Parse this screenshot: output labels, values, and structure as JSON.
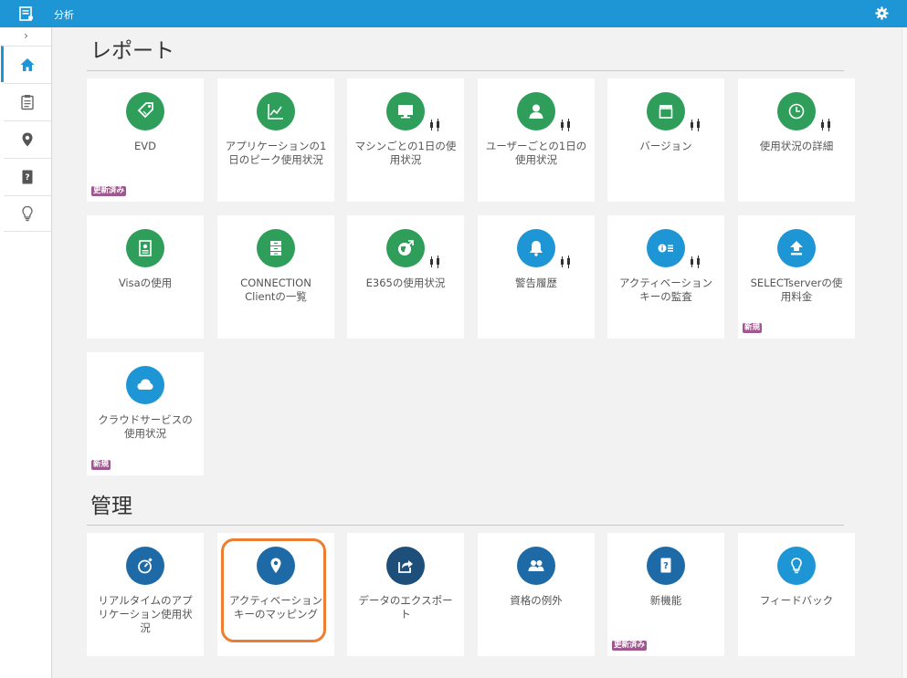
{
  "header": {
    "title": "分析",
    "app_icon": "report-app-icon",
    "settings_icon": "gear-icon",
    "accent": "#1e96d6"
  },
  "sidebar": {
    "expand_glyph": "›",
    "items": [
      {
        "name": "home",
        "icon": "home-icon",
        "active": true
      },
      {
        "name": "reports",
        "icon": "clipboard-icon"
      },
      {
        "name": "location",
        "icon": "map-pin-icon"
      },
      {
        "name": "help",
        "icon": "question-book-icon"
      },
      {
        "name": "ideas",
        "icon": "lightbulb-icon"
      }
    ]
  },
  "sections": {
    "reports": {
      "title": "レポート",
      "tiles": [
        {
          "label": "EVD",
          "icon": "tag-icon",
          "color": "#2f9e5a",
          "bars": false,
          "badge": "更新済み"
        },
        {
          "label": "アプリケーションの1日のピーク使用状況",
          "icon": "chart-line-icon",
          "color": "#2f9e5a",
          "bars": false,
          "badge": ""
        },
        {
          "label": "マシンごとの1日の使用状況",
          "icon": "monitor-icon",
          "color": "#2f9e5a",
          "bars": true,
          "badge": ""
        },
        {
          "label": "ユーザーごとの1日の使用状況",
          "icon": "user-icon",
          "color": "#2f9e5a",
          "bars": true,
          "badge": ""
        },
        {
          "label": "バージョン",
          "icon": "archive-icon",
          "color": "#2f9e5a",
          "bars": true,
          "badge": ""
        },
        {
          "label": "使用状況の詳細",
          "icon": "clock-icon",
          "color": "#2f9e5a",
          "bars": true,
          "badge": ""
        },
        {
          "label": "Visaの使用",
          "icon": "id-card-icon",
          "color": "#2f9e5a",
          "bars": false,
          "badge": ""
        },
        {
          "label": "CONNECTION Clientの一覧",
          "icon": "drawers-icon",
          "color": "#2f9e5a",
          "bars": false,
          "badge": ""
        },
        {
          "label": "E365の使用状況",
          "icon": "globe-icon",
          "color": "#2f9e5a",
          "bars": true,
          "badge": ""
        },
        {
          "label": "警告履歴",
          "icon": "bell-icon",
          "color": "#1e96d6",
          "bars": true,
          "badge": ""
        },
        {
          "label": "アクティベーションキーの監査",
          "icon": "info-list-icon",
          "color": "#1e96d6",
          "bars": true,
          "badge": ""
        },
        {
          "label": "SELECTserverの使用料金",
          "icon": "upload-icon",
          "color": "#1e96d6",
          "bars": false,
          "badge": "新規"
        },
        {
          "label": "クラウドサービスの使用状況",
          "icon": "cloud-icon",
          "color": "#1e96d6",
          "bars": false,
          "badge": "新規"
        }
      ]
    },
    "admin": {
      "title": "管理",
      "tiles": [
        {
          "label": "リアルタイムのアプリケーション使用状況",
          "icon": "stopwatch-icon",
          "color": "#1e6aa6",
          "bars": false,
          "badge": ""
        },
        {
          "label": "アクティベーションキーのマッピング",
          "icon": "map-pin-icon",
          "color": "#1e6aa6",
          "bars": false,
          "badge": "",
          "highlighted": true
        },
        {
          "label": "データのエクスポート",
          "icon": "export-icon",
          "color": "#1e4f7a",
          "bars": false,
          "badge": ""
        },
        {
          "label": "資格の例外",
          "icon": "users-icon",
          "color": "#1e6aa6",
          "bars": false,
          "badge": ""
        },
        {
          "label": "新機能",
          "icon": "question-book-icon",
          "color": "#1e6aa6",
          "bars": false,
          "badge": "更新済み"
        },
        {
          "label": "フィードバック",
          "icon": "lightbulb-icon",
          "color": "#1e96d6",
          "bars": false,
          "badge": ""
        }
      ]
    }
  }
}
